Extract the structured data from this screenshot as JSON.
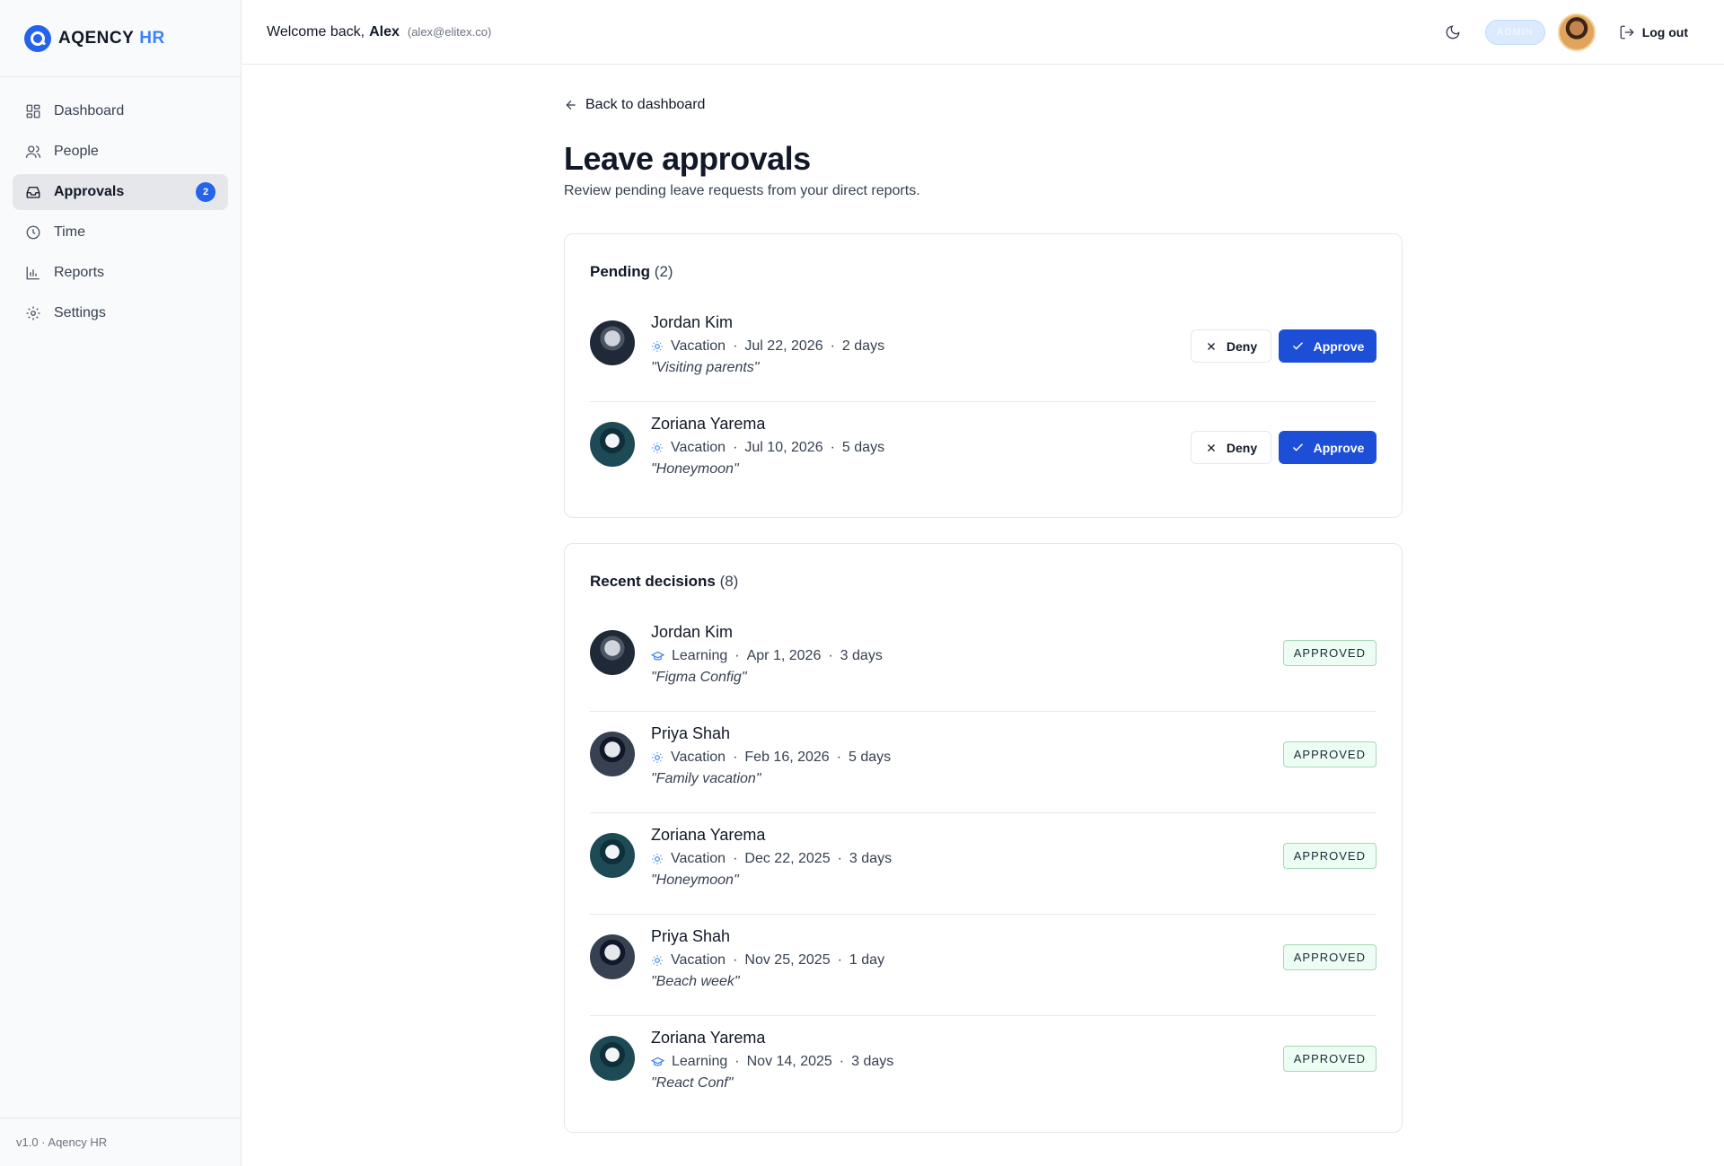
{
  "brand": {
    "name": "AQENCY",
    "accent": "HR"
  },
  "sidebar": {
    "items": [
      {
        "label": "Dashboard",
        "icon": "grid-icon"
      },
      {
        "label": "People",
        "icon": "users-icon"
      },
      {
        "label": "Approvals",
        "icon": "inbox-icon",
        "badge": "2",
        "active": true
      },
      {
        "label": "Time",
        "icon": "clock-icon"
      },
      {
        "label": "Reports",
        "icon": "bar-chart-icon"
      },
      {
        "label": "Settings",
        "icon": "gear-icon"
      }
    ],
    "footer": "v1.0 · Aqency HR"
  },
  "header": {
    "welcome_prefix": "Welcome back,",
    "user_name": "Alex",
    "user_email": "(alex@elitex.co)",
    "role_badge": "ADMIN",
    "logout_label": "Log out"
  },
  "main": {
    "back_label": "Back to dashboard",
    "title": "Leave approvals",
    "subtitle": "Review pending leave requests from your direct reports."
  },
  "pending": {
    "title": "Pending",
    "count": "(2)",
    "deny_label": "Deny",
    "approve_label": "Approve",
    "items": [
      {
        "name": "Jordan Kim",
        "type": "Vacation",
        "type_icon": "sun-icon",
        "date": "Jul 22, 2026",
        "duration": "2 days",
        "note": "\"Visiting parents\""
      },
      {
        "name": "Zoriana Yarema",
        "type": "Vacation",
        "type_icon": "sun-icon",
        "date": "Jul 10, 2026",
        "duration": "5 days",
        "note": "\"Honeymoon\""
      }
    ]
  },
  "recent": {
    "title": "Recent decisions",
    "count": "(8)",
    "items": [
      {
        "name": "Jordan Kim",
        "type": "Learning",
        "type_icon": "graduation-cap-icon",
        "date": "Apr 1, 2026",
        "duration": "3 days",
        "note": "\"Figma Config\"",
        "status": "APPROVED"
      },
      {
        "name": "Priya Shah",
        "type": "Vacation",
        "type_icon": "sun-icon",
        "date": "Feb 16, 2026",
        "duration": "5 days",
        "note": "\"Family vacation\"",
        "status": "APPROVED"
      },
      {
        "name": "Zoriana Yarema",
        "type": "Vacation",
        "type_icon": "sun-icon",
        "date": "Dec 22, 2025",
        "duration": "3 days",
        "note": "\"Honeymoon\"",
        "status": "APPROVED"
      },
      {
        "name": "Priya Shah",
        "type": "Vacation",
        "type_icon": "sun-icon",
        "date": "Nov 25, 2025",
        "duration": "1 day",
        "note": "\"Beach week\"",
        "status": "APPROVED"
      },
      {
        "name": "Zoriana Yarema",
        "type": "Learning",
        "type_icon": "graduation-cap-icon",
        "date": "Nov 14, 2025",
        "duration": "3 days",
        "note": "\"React Conf\"",
        "status": "APPROVED"
      }
    ]
  },
  "colors": {
    "accent": "#1d4ed8",
    "badge_blue": "#2563eb",
    "approved_bg": "#ecfdf3",
    "approved_border": "#a7d7b4"
  }
}
